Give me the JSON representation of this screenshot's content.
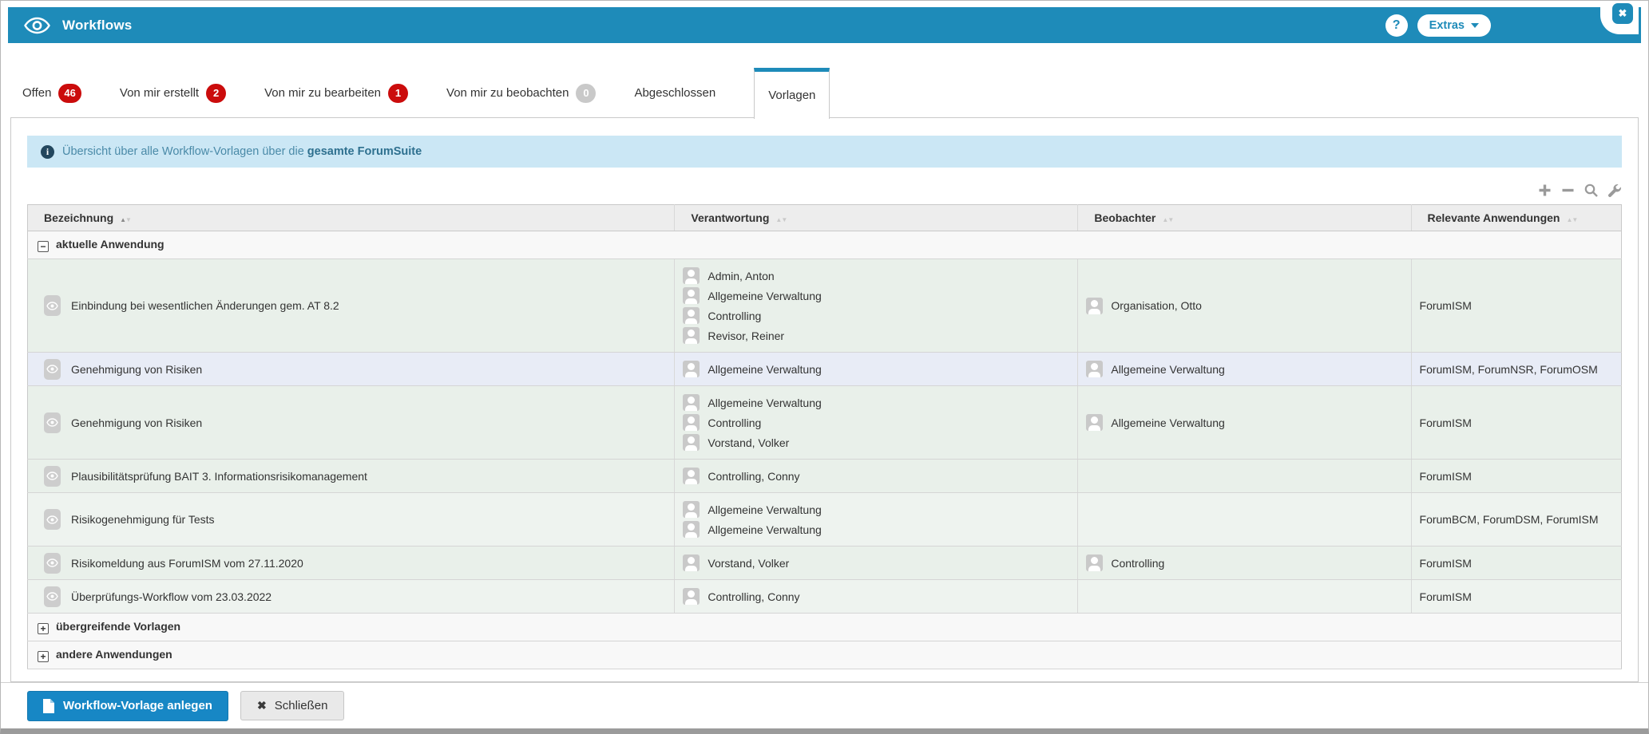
{
  "header": {
    "title": "Workflows",
    "help": "?",
    "extras": "Extras",
    "close": "✖"
  },
  "tabs": [
    {
      "id": "offen",
      "label": "Offen",
      "badge": "46",
      "badge_color": "red",
      "active": false
    },
    {
      "id": "von-mir-erstellt",
      "label": "Von mir erstellt",
      "badge": "2",
      "badge_color": "red",
      "active": false
    },
    {
      "id": "von-mir-zu-bearbeiten",
      "label": "Von mir zu bearbeiten",
      "badge": "1",
      "badge_color": "red",
      "active": false
    },
    {
      "id": "von-mir-zu-beobachten",
      "label": "Von mir zu beobachten",
      "badge": "0",
      "badge_color": "gray",
      "active": false
    },
    {
      "id": "abgeschlossen",
      "label": "Abgeschlossen",
      "badge": null,
      "badge_color": null,
      "active": false
    },
    {
      "id": "vorlagen",
      "label": "Vorlagen",
      "badge": null,
      "badge_color": null,
      "active": true
    }
  ],
  "info_banner": {
    "icon": "info-icon",
    "text": "Übersicht über alle Workflow-Vorlagen über die",
    "bold_text": "gesamte ForumSuite"
  },
  "toolbar": {
    "icons": [
      "plus-icon",
      "minus-icon",
      "search-icon",
      "wrench-icon"
    ]
  },
  "table": {
    "columns": [
      {
        "label": "Bezeichnung",
        "sort": "active"
      },
      {
        "label": "Verantwortung",
        "sort": "inactive"
      },
      {
        "label": "Beobachter",
        "sort": "inactive"
      },
      {
        "label": "Relevante Anwendungen",
        "sort": "inactive"
      }
    ],
    "groups": [
      {
        "label": "aktuelle Anwendung",
        "expanded": true,
        "rows": [
          {
            "name": "Einbindung bei wesentlichen Änderungen gem. AT 8.2",
            "responsible": [
              "Admin, Anton",
              "Allgemeine Verwaltung",
              "Controlling",
              "Revisor, Reiner"
            ],
            "observers": [
              "Organisation, Otto"
            ],
            "applications": "ForumISM",
            "tint": "green"
          },
          {
            "name": "Genehmigung von Risiken",
            "responsible": [
              "Allgemeine Verwaltung"
            ],
            "observers": [
              "Allgemeine Verwaltung"
            ],
            "applications": "ForumISM, ForumNSR, ForumOSM",
            "tint": "blue"
          },
          {
            "name": "Genehmigung von Risiken",
            "responsible": [
              "Allgemeine Verwaltung",
              "Controlling",
              "Vorstand, Volker"
            ],
            "observers": [
              "Allgemeine Verwaltung"
            ],
            "applications": "ForumISM",
            "tint": "green"
          },
          {
            "name": "Plausibilitätsprüfung BAIT 3. Informationsrisikomanagement",
            "responsible": [
              "Controlling, Conny"
            ],
            "observers": [],
            "applications": "ForumISM",
            "tint": "green"
          },
          {
            "name": "Risikogenehmigung für Tests",
            "responsible": [
              "Allgemeine Verwaltung",
              "Allgemeine Verwaltung"
            ],
            "observers": [],
            "applications": "ForumBCM, ForumDSM, ForumISM",
            "tint": "light"
          },
          {
            "name": "Risikomeldung aus ForumISM vom 27.11.2020",
            "responsible": [
              "Vorstand, Volker"
            ],
            "observers": [
              "Controlling"
            ],
            "applications": "ForumISM",
            "tint": "green"
          },
          {
            "name": "Überprüfungs-Workflow vom 23.03.2022",
            "responsible": [
              "Controlling, Conny"
            ],
            "observers": [],
            "applications": "ForumISM",
            "tint": "light"
          }
        ]
      },
      {
        "label": "übergreifende Vorlagen",
        "expanded": false,
        "rows": []
      },
      {
        "label": "andere Anwendungen",
        "expanded": false,
        "rows": []
      }
    ]
  },
  "footer": {
    "create_button": "Workflow-Vorlage anlegen",
    "close_button": "Schließen"
  },
  "colors": {
    "accent_blue": "#1e8bb9",
    "button_blue": "#1787c5",
    "badge_red": "#cb0c0c",
    "info_banner_bg": "#cbe7f5",
    "row_green": "#e9f0ea",
    "row_blue": "#e8ecf6"
  }
}
